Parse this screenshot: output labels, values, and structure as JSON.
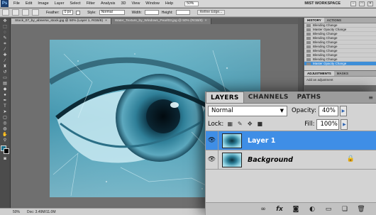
{
  "menubar": {
    "logo": "Ps",
    "items": [
      "File",
      "Edit",
      "Image",
      "Layer",
      "Select",
      "Filter",
      "Analysis",
      "3D",
      "View",
      "Window",
      "Help"
    ],
    "zoom": "50%",
    "workspace": "MIST WORKSPACE",
    "win_min": "–",
    "win_max": "□",
    "win_close": "✕"
  },
  "options": {
    "feather_label": "Feather:",
    "feather_value": "0 px",
    "style_label": "Style:",
    "style_value": "Normal",
    "width_label": "Width:",
    "height_label": "Height:",
    "refine_label": "Refine Edge..."
  },
  "tabs": [
    {
      "label": "Stock_07_by_abnerse_stock.jpg @ 50% (Layer 1, RGB/8)",
      "close": "×"
    },
    {
      "label": "Water_Texture_by_Windows_Pearl03.jpg @ 50% (RGB/8)",
      "close": "×"
    }
  ],
  "status": {
    "zoom": "50%",
    "doc": "Doc: 3.49M/11.0M"
  },
  "history": {
    "tabs": [
      "HISTORY",
      "ACTIONS"
    ],
    "items": [
      {
        "label": "Blending Change"
      },
      {
        "label": "Master Opacity Change"
      },
      {
        "label": "Blending Change"
      },
      {
        "label": "Blending Change"
      },
      {
        "label": "Blending Change"
      },
      {
        "label": "Blending Change"
      },
      {
        "label": "Blending Change"
      },
      {
        "label": "Blending Change"
      },
      {
        "label": "Blending Change"
      },
      {
        "label": "Master Opacity Change"
      }
    ]
  },
  "adjustments": {
    "tabs": [
      "ADJUSTMENTS",
      "MASKS"
    ],
    "text": "Add an adjustment"
  },
  "layers_panel": {
    "tabs": [
      "LAYERS",
      "CHANNELS",
      "PATHS"
    ],
    "menu_icon": "≡",
    "blend_mode": "Normal",
    "opacity_label": "Opacity:",
    "opacity_value": "40%",
    "lock_label": "Lock:",
    "fill_label": "Fill:",
    "fill_value": "100%",
    "layers": [
      {
        "name": "Layer 1",
        "selected": true,
        "locked": false
      },
      {
        "name": "Background",
        "selected": false,
        "locked": true
      }
    ],
    "bottom_icons": [
      "link-layers",
      "fx",
      "add-mask",
      "adjustment",
      "group",
      "new-layer",
      "delete"
    ]
  },
  "colors": {
    "selection": "#3f8ee6",
    "panel_bg": "#d3d3d3",
    "accent_link": "#2f64b0"
  }
}
